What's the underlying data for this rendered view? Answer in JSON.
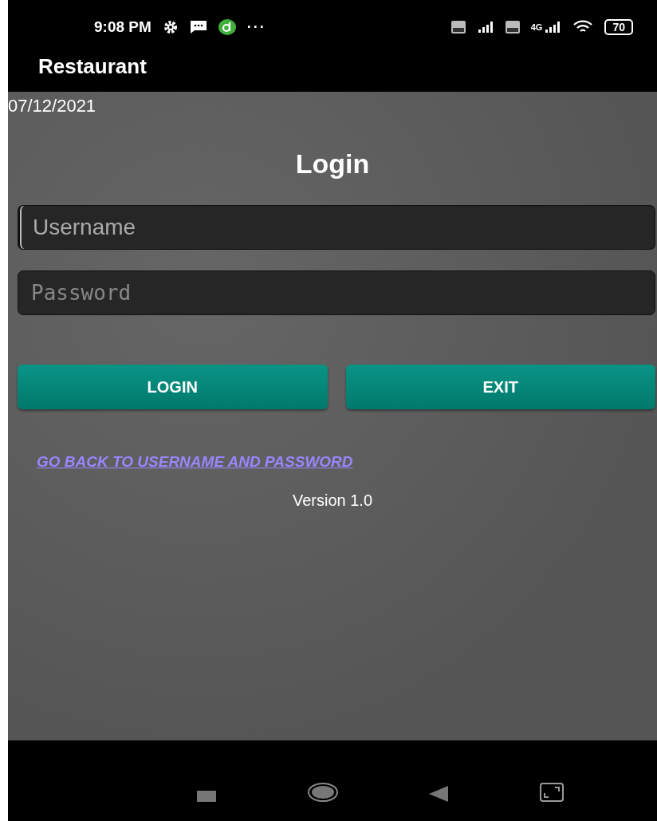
{
  "status_bar": {
    "time": "9:08 PM",
    "more": "···",
    "network": "4G",
    "battery": "70"
  },
  "app_bar": {
    "title": "Restaurant"
  },
  "date": "07/12/2021",
  "heading": "Login",
  "fields": [
    {
      "kind": "text",
      "placeholder": "Username",
      "focused": true
    },
    {
      "kind": "password",
      "placeholder": "Password",
      "focused": false
    }
  ],
  "buttons": [
    {
      "label": "LOGIN"
    },
    {
      "label": "EXIT"
    }
  ],
  "link": "GO BACK TO USERNAME AND PASSWORD",
  "version": "Version 1.0"
}
